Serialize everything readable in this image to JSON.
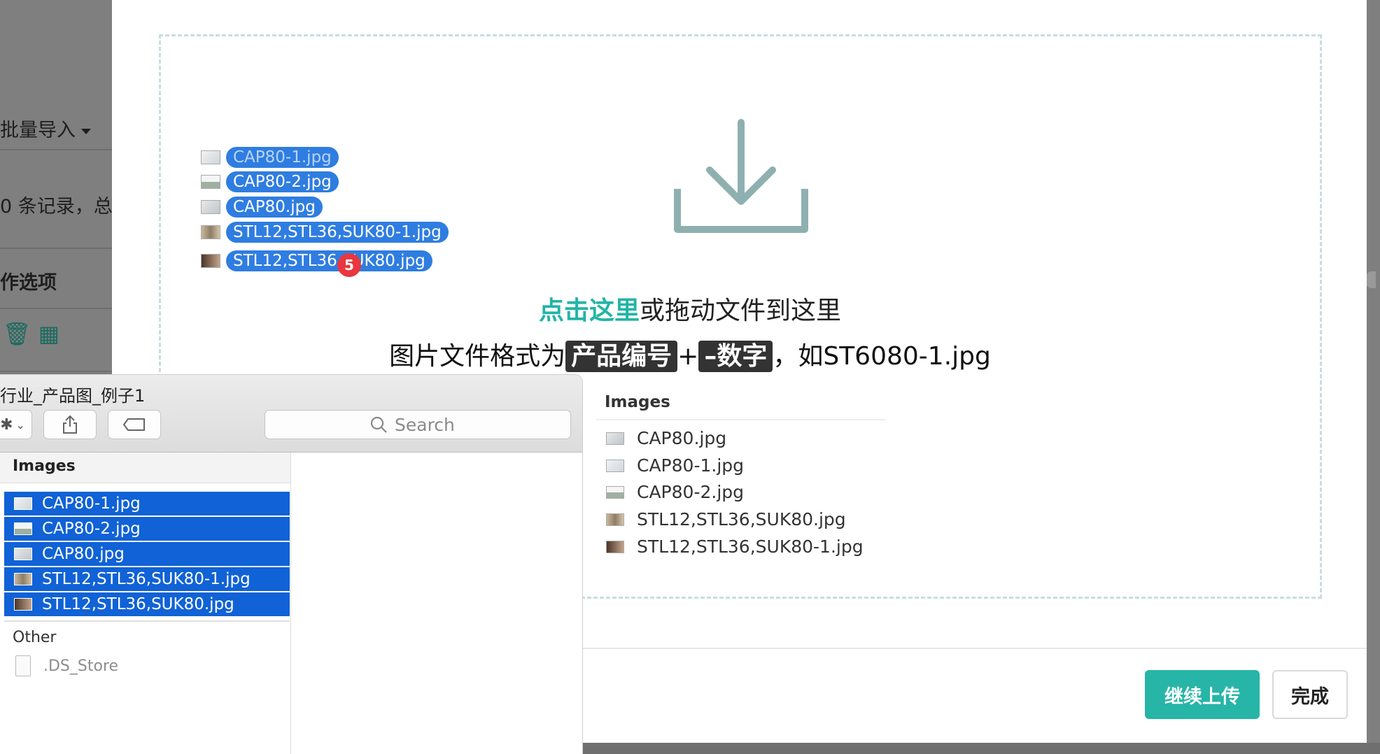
{
  "background": {
    "bulk_import": "批量导入",
    "records_text": "0 条记录，总",
    "options_header": "作选项",
    "action_icons": "🗑 ▦"
  },
  "modal": {
    "hint_link": "点击这里",
    "hint_rest": "或拖动文件到这里",
    "format_prefix": "图片文件格式为",
    "tag_product": "产品编号",
    "plus": "+",
    "tag_number": "–数字",
    "format_example": "，如ST6080-1.jpg",
    "btn_continue": "继续上传",
    "btn_done": "完成"
  },
  "drag_items": [
    {
      "name": "CAP80-1.jpg"
    },
    {
      "name": "CAP80-2.jpg"
    },
    {
      "name": "CAP80.jpg"
    },
    {
      "name": "STL12,STL36,SUK80-1.jpg"
    },
    {
      "name": "STL12,STL36,SUK80.jpg"
    }
  ],
  "drag_badge": "5",
  "ghost_list": {
    "title": "Images",
    "items": [
      "CAP80.jpg",
      "CAP80-1.jpg",
      "CAP80-2.jpg",
      "STL12,STL36,SUK80.jpg",
      "STL12,STL36,SUK80-1.jpg"
    ]
  },
  "finder": {
    "title": "行业_产品图_例子1",
    "search_placeholder": "Search",
    "images_header": "Images",
    "files": [
      "CAP80-1.jpg",
      "CAP80-2.jpg",
      "CAP80.jpg",
      "STL12,STL36,SUK80-1.jpg",
      "STL12,STL36,SUK80.jpg"
    ],
    "other_header": "Other",
    "other_files": [
      ".DS_Store"
    ]
  },
  "colors": {
    "accent": "#26b5a6",
    "selection": "#1062d6",
    "chip": "#2f7de1",
    "badge": "#e8373e"
  }
}
